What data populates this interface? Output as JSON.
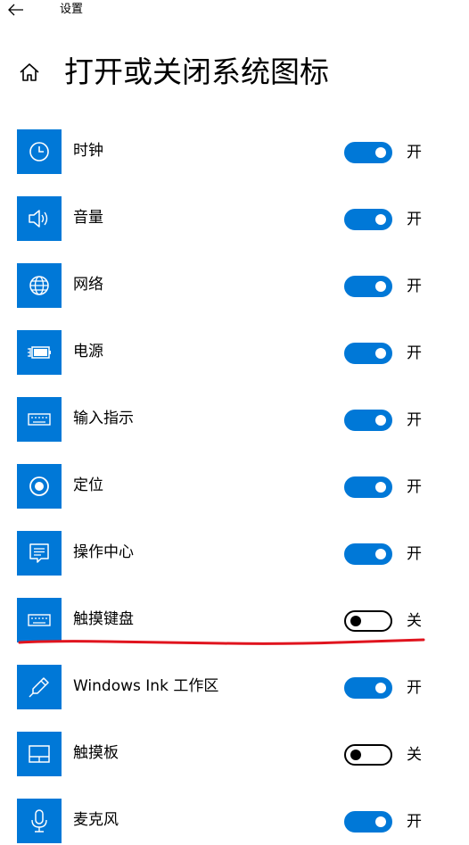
{
  "window": {
    "title": "设置",
    "back_icon": "back-arrow-icon"
  },
  "header": {
    "home_icon": "home-icon",
    "title": "打开或关闭系统图标"
  },
  "colors": {
    "accent": "#0078d7",
    "annotation": "#e0141e"
  },
  "items": [
    {
      "label": "时钟",
      "icon": "clock-icon",
      "on": true,
      "state_label": "开"
    },
    {
      "label": "音量",
      "icon": "volume-icon",
      "on": true,
      "state_label": "开"
    },
    {
      "label": "网络",
      "icon": "globe-icon",
      "on": true,
      "state_label": "开"
    },
    {
      "label": "电源",
      "icon": "battery-icon",
      "on": true,
      "state_label": "开"
    },
    {
      "label": "输入指示",
      "icon": "keyboard-icon",
      "on": true,
      "state_label": "开"
    },
    {
      "label": "定位",
      "icon": "location-icon",
      "on": true,
      "state_label": "开"
    },
    {
      "label": "操作中心",
      "icon": "action-center-icon",
      "on": true,
      "state_label": "开"
    },
    {
      "label": "触摸键盘",
      "icon": "touch-keyboard-icon",
      "on": false,
      "state_label": "关"
    },
    {
      "label": "Windows Ink 工作区",
      "icon": "pen-icon",
      "on": true,
      "state_label": "开"
    },
    {
      "label": "触摸板",
      "icon": "touchpad-icon",
      "on": false,
      "state_label": "关"
    },
    {
      "label": "麦克风",
      "icon": "microphone-icon",
      "on": true,
      "state_label": "开"
    }
  ]
}
